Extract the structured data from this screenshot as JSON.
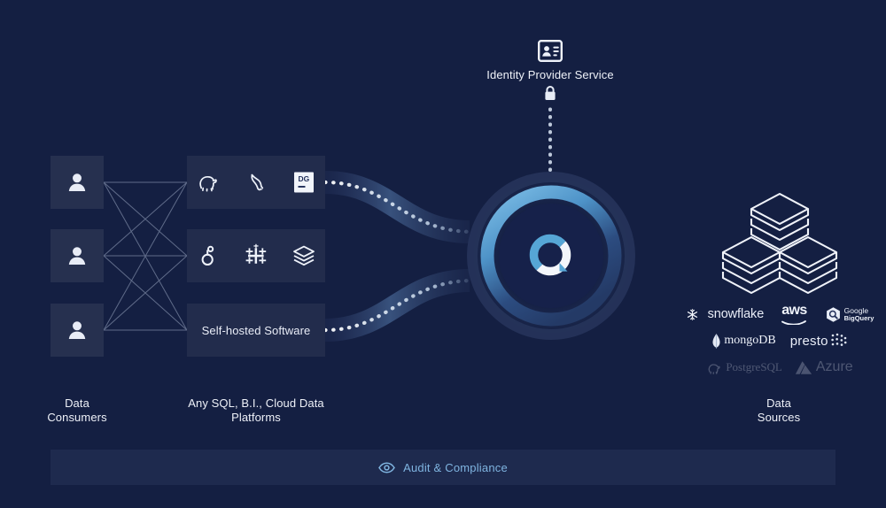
{
  "theme": {
    "background": "#141f42",
    "box_fill": "#222c4c",
    "consumer_box_fill": "#26304f",
    "audit_bar_fill": "#1e2a4e",
    "accent_blue": "#4f9bd0",
    "accent_light": "#7fb4e0",
    "text_primary": "#eef1f8",
    "ring_outer": "#2c3a63",
    "ring_inner": "#5aa2d6"
  },
  "identity": {
    "icon": "id-card-icon",
    "label": "Identity Provider Service",
    "lock_icon": "lock-icon"
  },
  "consumers": {
    "group_label": "Data\nConsumers",
    "items": [
      {
        "icon": "person-icon",
        "name": "data-consumer-1"
      },
      {
        "icon": "person-icon",
        "name": "data-consumer-2"
      },
      {
        "icon": "person-icon",
        "name": "data-consumer-3"
      }
    ]
  },
  "platforms": {
    "group_label": "Any SQL, B.I., Cloud Data\nPlatforms",
    "rows": [
      {
        "type": "icons",
        "tools": [
          {
            "icon": "postgresql-elephant-icon",
            "name": "postgresql"
          },
          {
            "icon": "mysql-dolphin-icon",
            "name": "mysql"
          },
          {
            "icon": "datagrip-dg-icon",
            "name": "datagrip",
            "badge": "DG"
          }
        ]
      },
      {
        "type": "icons",
        "tools": [
          {
            "icon": "looker-icon",
            "name": "looker"
          },
          {
            "icon": "tableau-icon",
            "name": "tableau"
          },
          {
            "icon": "databricks-icon",
            "name": "databricks"
          }
        ]
      },
      {
        "type": "text",
        "text": "Self-hosted Software"
      }
    ]
  },
  "hub": {
    "name": "central-platform-hub",
    "logo": "immuta-ring-logo"
  },
  "sources": {
    "group_label": "Data\nSources",
    "stack_icon": "server-cubes-icon",
    "logos": [
      [
        {
          "name": "snowflake",
          "text": "snowflake",
          "icon": "snowflake-icon",
          "dim": false
        },
        {
          "name": "aws",
          "text": "aws",
          "icon": "aws-icon",
          "dim": false
        },
        {
          "name": "google-bigquery",
          "text": "Google BigQuery",
          "icon": "bigquery-icon",
          "dim": false
        }
      ],
      [
        {
          "name": "mongodb",
          "text": "mongoDB",
          "icon": "mongodb-leaf-icon",
          "dim": false
        },
        {
          "name": "presto",
          "text": "presto",
          "icon": "presto-dots-icon",
          "dim": false
        }
      ],
      [
        {
          "name": "postgresql",
          "text": "PostgreSQL",
          "icon": "postgresql-elephant-icon",
          "dim": true
        },
        {
          "name": "azure",
          "text": "Azure",
          "icon": "azure-icon",
          "dim": true
        }
      ]
    ]
  },
  "audit": {
    "icon": "eye-icon",
    "label": "Audit & Compliance"
  }
}
